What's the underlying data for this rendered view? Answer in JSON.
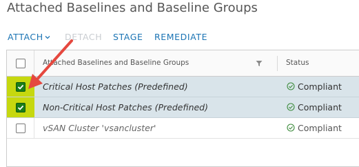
{
  "page": {
    "title": "Attached Baselines and Baseline Groups"
  },
  "toolbar": {
    "attach_label": "ATTACH",
    "detach_label": "DETACH",
    "stage_label": "STAGE",
    "remediate_label": "REMEDIATE"
  },
  "grid": {
    "columns": {
      "name": "Attached Baselines and Baseline Groups",
      "status": "Status"
    },
    "rows": [
      {
        "name": "Critical Host Patches (Predefined)",
        "status": "Compliant",
        "selected": true
      },
      {
        "name": "Non-Critical Host Patches (Predefined)",
        "status": "Compliant",
        "selected": true
      },
      {
        "name": "vSAN Cluster 'vsancluster'",
        "status": "Compliant",
        "selected": false
      }
    ]
  },
  "colors": {
    "accent": "#1b74b4",
    "highlight": "#c6d80f",
    "checked": "#1a7d1a",
    "annotation_arrow": "#e5483f",
    "selected_row": "#d9e4ea",
    "compliant_icon": "#3c8b3c"
  },
  "icons": {
    "attach_dropdown": "chevron-down-icon",
    "column_filter": "filter-icon",
    "status": "check-circle-icon",
    "annotation": "arrow-icon"
  }
}
